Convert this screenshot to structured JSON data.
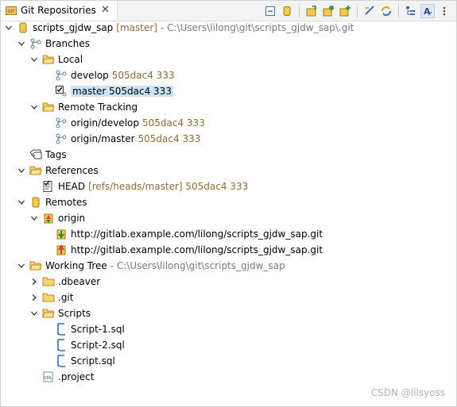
{
  "view": {
    "tab_title": "Git Repositories",
    "tab_icon": "git-repositories-icon",
    "close_glyph": "✕"
  },
  "toolbar": {
    "buttons": [
      "collapse-all-icon",
      "add-repository-icon",
      "clone-repository-icon",
      "create-repository-icon",
      "link-with-selection-icon",
      "refresh-icon",
      "hierarchical-branch-layout-icon",
      "active-toggle-icon",
      "view-menu-icon"
    ]
  },
  "tree": {
    "repo": {
      "label": "scripts_gjdw_sap",
      "branch": "[master]",
      "path": "- C:\\Users\\lilong\\git\\scripts_gjdw_sap\\.git"
    },
    "branches": {
      "label": "Branches"
    },
    "local": {
      "label": "Local"
    },
    "develop": {
      "label": "develop",
      "dec": "505dac4 333"
    },
    "master": {
      "label": "master 505dac4 333"
    },
    "remote_tracking": {
      "label": "Remote Tracking"
    },
    "origin_develop": {
      "label": "origin/develop",
      "dec": "505dac4 333"
    },
    "origin_master": {
      "label": "origin/master",
      "dec": "505dac4 333"
    },
    "tags": {
      "label": "Tags"
    },
    "references": {
      "label": "References"
    },
    "head": {
      "label": "HEAD",
      "dec": "[refs/heads/master] 505dac4 333"
    },
    "remotes": {
      "label": "Remotes"
    },
    "origin": {
      "label": "origin"
    },
    "fetch_url": {
      "label": "http://gitlab.example.com/lilong/scripts_gjdw_sap.git"
    },
    "push_url": {
      "label": "http://gitlab.example.com/lilong/scripts_gjdw_sap.git"
    },
    "working_tree": {
      "label": "Working Tree",
      "path": "- C:\\Users\\lilong\\git\\scripts_gjdw_sap"
    },
    "dbeaver": {
      "label": ".dbeaver"
    },
    "git": {
      "label": ".git"
    },
    "scripts": {
      "label": "Scripts"
    },
    "script1": {
      "label": "Script-1.sql"
    },
    "script2": {
      "label": "Script-2.sql"
    },
    "script": {
      "label": "Script.sql"
    },
    "project": {
      "label": ".project"
    }
  },
  "watermark": "CSDN @lilsyoss",
  "colors": {
    "decoration": "#8a6d3b",
    "selection": "#cce4f7",
    "folder": "#e8b84a",
    "branch_icon": "#5a7f9c"
  }
}
